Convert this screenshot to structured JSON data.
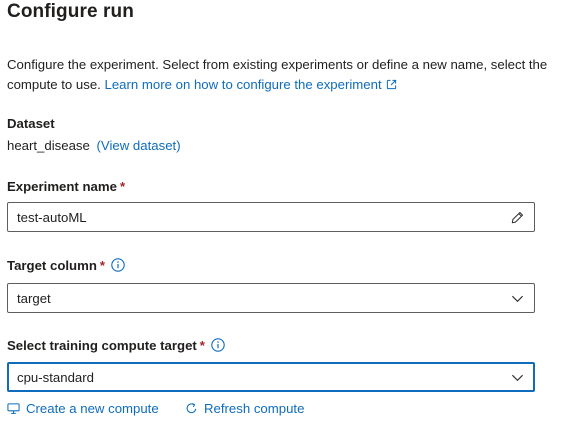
{
  "header": {
    "title": "Configure run"
  },
  "description": {
    "line1": "Configure the experiment. Select from existing experiments or define a new name, select the",
    "line2_prefix": "compute to use.",
    "link_text": "Learn more on how to configure the experiment",
    "link_icon": "external-link-icon"
  },
  "dataset": {
    "label": "Dataset",
    "name": "heart_disease",
    "view_link": "(View dataset)"
  },
  "experiment_name": {
    "label": "Experiment name",
    "required_marker": "*",
    "value": "test-autoML",
    "trail_icon": "edit-pencil-icon"
  },
  "target_column": {
    "label": "Target column",
    "required_marker": "*",
    "info_icon": "info-icon",
    "selected": "target",
    "trail_icon": "chevron-down-icon"
  },
  "compute_target": {
    "label": "Select training compute target",
    "required_marker": "*",
    "info_icon": "info-icon",
    "selected": "cpu-standard",
    "trail_icon": "chevron-down-icon"
  },
  "actions": {
    "create_label": "Create a new compute",
    "create_icon": "compute-icon",
    "refresh_label": "Refresh compute",
    "refresh_icon": "refresh-icon"
  },
  "colors": {
    "accent": "#0f6cbd",
    "required": "#a4262c",
    "text": "#201f1e",
    "border": "#605e5c"
  }
}
